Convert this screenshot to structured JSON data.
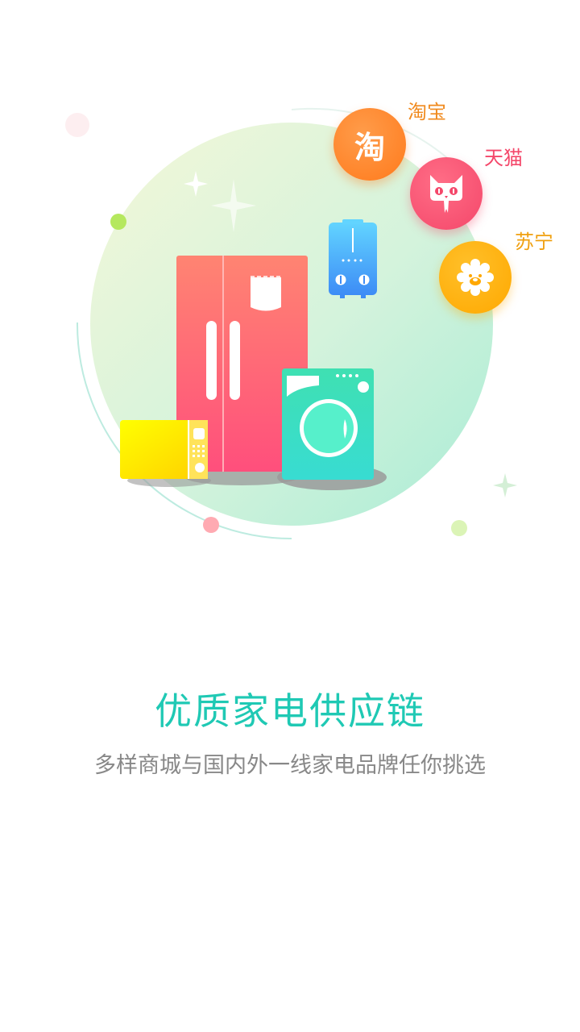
{
  "brands": [
    {
      "key": "taobao",
      "label": "淘宝",
      "icon": "taobao-logo-icon",
      "color": "#ff7a1c",
      "glyph": "淘"
    },
    {
      "key": "tmall",
      "label": "天猫",
      "icon": "tmall-cat-icon",
      "color": "#f4476a"
    },
    {
      "key": "suning",
      "label": "苏宁",
      "icon": "suning-lion-icon",
      "color": "#ffa800"
    }
  ],
  "appliances": [
    {
      "name": "refrigerator",
      "icon": "refrigerator-icon"
    },
    {
      "name": "washing-machine",
      "icon": "washing-machine-icon"
    },
    {
      "name": "microwave",
      "icon": "microwave-icon"
    },
    {
      "name": "water-heater",
      "icon": "water-heater-icon"
    }
  ],
  "headline": "优质家电供应链",
  "subheadline": "多样商城与国内外一线家电品牌任你挑选",
  "colors": {
    "accent": "#1fc9b4",
    "subtext": "#888888",
    "background": "#ffffff"
  }
}
